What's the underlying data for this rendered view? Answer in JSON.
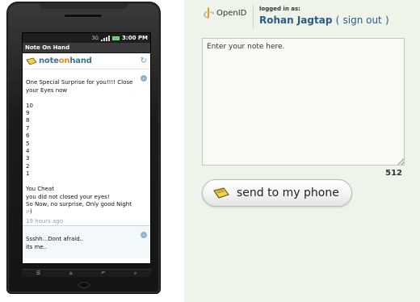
{
  "phone": {
    "status": {
      "network": "3G",
      "time": "3:00 PM"
    },
    "app_title": "Note On Hand",
    "brand": {
      "part1": "note",
      "part2": "on",
      "part3": "hand"
    },
    "notes": [
      {
        "text": "One Special Surprise for you!!!! Close your Eyes now\n\n10\n9\n8\n7\n6\n5\n4\n3\n2\n1\n\nYou Cheat\nyou did not closed your eyes!\nSo Now, no surprise, Only good Night :-)",
        "time": "19 hours ago"
      },
      {
        "text": "Ssshh...Dont afraid..\nits me..",
        "time": ""
      }
    ]
  },
  "panel": {
    "openid_label": "OpenID",
    "logged_in_label": "logged in as:",
    "user_name": "Rohan Jagtap",
    "open_paren": "(",
    "sign_out": "sign out",
    "close_paren": ")",
    "note_placeholder": "Enter your note here.",
    "char_count": "512",
    "send_label": "send to my phone"
  }
}
